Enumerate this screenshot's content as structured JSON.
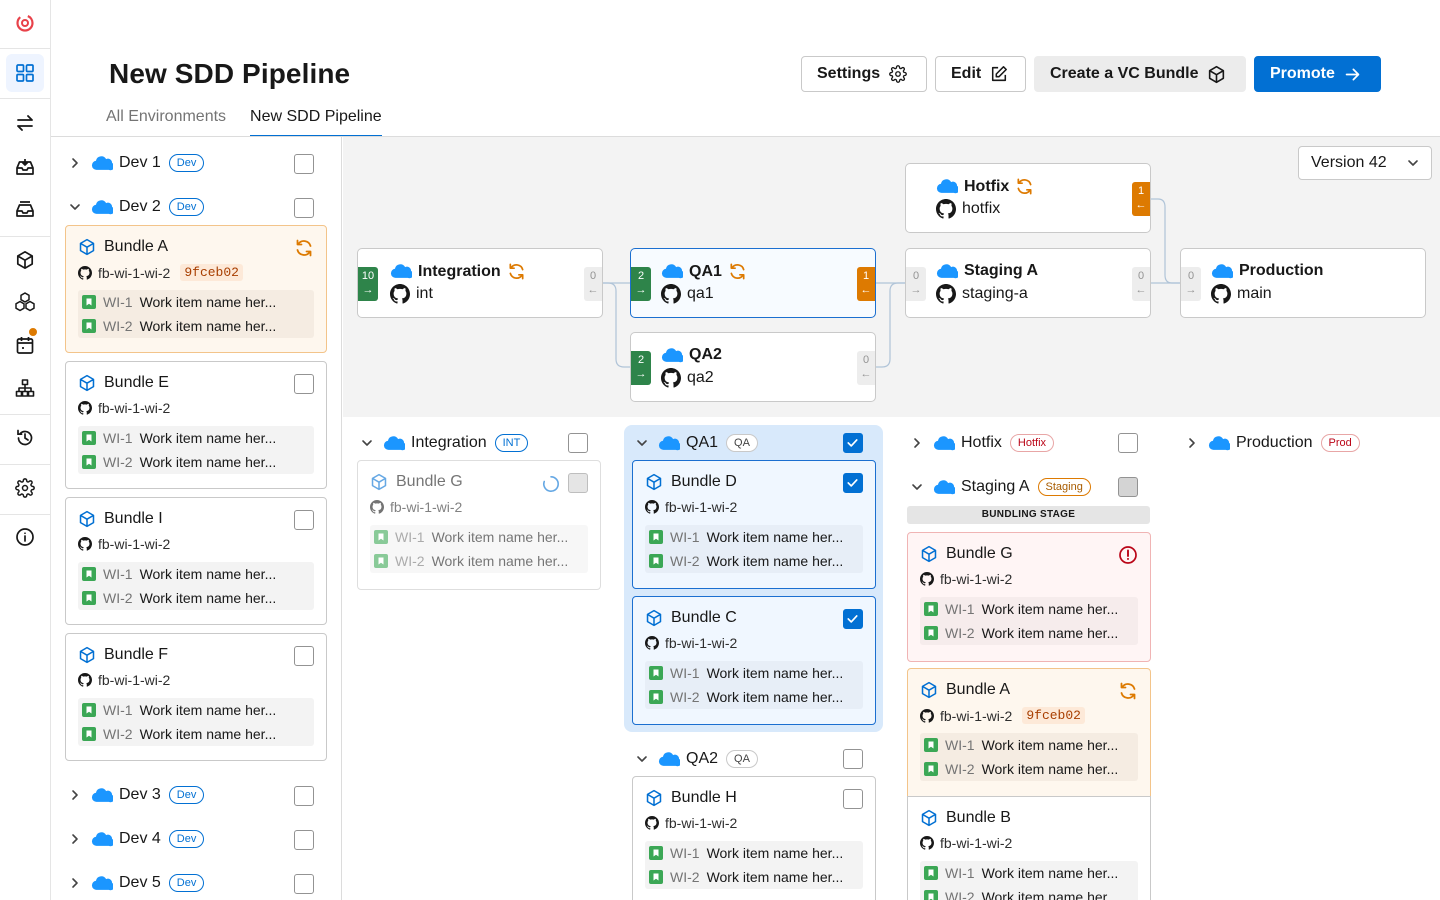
{
  "header": {
    "title": "New SDD Pipeline",
    "buttons": {
      "settings": "Settings",
      "edit": "Edit",
      "create_bundle": "Create a VC Bundle",
      "promote": "Promote"
    },
    "tabs": [
      "All Environments",
      "New SDD Pipeline"
    ]
  },
  "version": "Version 42",
  "colors": {
    "primary": "#0270d3",
    "green": "#2e844a",
    "orange": "#dd7a01",
    "salesforce": "#1b96ff"
  },
  "left_envs": {
    "dev1": {
      "name": "Dev 1",
      "badge": "Dev"
    },
    "dev2": {
      "name": "Dev 2",
      "badge": "Dev"
    },
    "dev3": {
      "name": "Dev 3",
      "badge": "Dev"
    },
    "dev4": {
      "name": "Dev 4",
      "badge": "Dev"
    },
    "dev5": {
      "name": "Dev 5",
      "badge": "Dev"
    }
  },
  "work_items": {
    "wi1": "WI-1",
    "wi2": "WI-2",
    "name": "Work item name her..."
  },
  "bundles": {
    "a": {
      "name": "Bundle A",
      "branch": "fb-wi-1-wi-2",
      "sha": "9fceb02"
    },
    "e": {
      "name": "Bundle E",
      "branch": "fb-wi-1-wi-2"
    },
    "i": {
      "name": "Bundle I",
      "branch": "fb-wi-1-wi-2"
    },
    "f": {
      "name": "Bundle F",
      "branch": "fb-wi-1-wi-2"
    },
    "g": {
      "name": "Bundle G",
      "branch": "fb-wi-1-wi-2"
    },
    "d": {
      "name": "Bundle D",
      "branch": "fb-wi-1-wi-2"
    },
    "c": {
      "name": "Bundle C",
      "branch": "fb-wi-1-wi-2"
    },
    "h": {
      "name": "Bundle H",
      "branch": "fb-wi-1-wi-2"
    },
    "b": {
      "name": "Bundle B",
      "branch": "fb-wi-1-wi-2"
    }
  },
  "pipeline": {
    "integration": {
      "name": "Integration",
      "branch": "int",
      "in": "10",
      "out": "0"
    },
    "qa1": {
      "name": "QA1",
      "branch": "qa1",
      "in": "2",
      "out": "1"
    },
    "qa2": {
      "name": "QA2",
      "branch": "qa2",
      "in": "2",
      "out": "0"
    },
    "hotfix": {
      "name": "Hotfix",
      "branch": "hotfix",
      "out": "1"
    },
    "staging": {
      "name": "Staging A",
      "branch": "staging-a",
      "in": "0",
      "out": "0"
    },
    "production": {
      "name": "Production",
      "branch": "main",
      "in": "0"
    }
  },
  "columns": {
    "integration": {
      "name": "Integration",
      "badge": "INT"
    },
    "qa1": {
      "name": "QA1",
      "badge": "QA"
    },
    "qa2": {
      "name": "QA2",
      "badge": "QA"
    },
    "hotfix": {
      "name": "Hotfix",
      "badge": "Hotfix"
    },
    "staging": {
      "name": "Staging A",
      "badge": "Staging"
    },
    "production": {
      "name": "Production",
      "badge": "Prod"
    }
  },
  "stage_label": "BUNDLING STAGE"
}
